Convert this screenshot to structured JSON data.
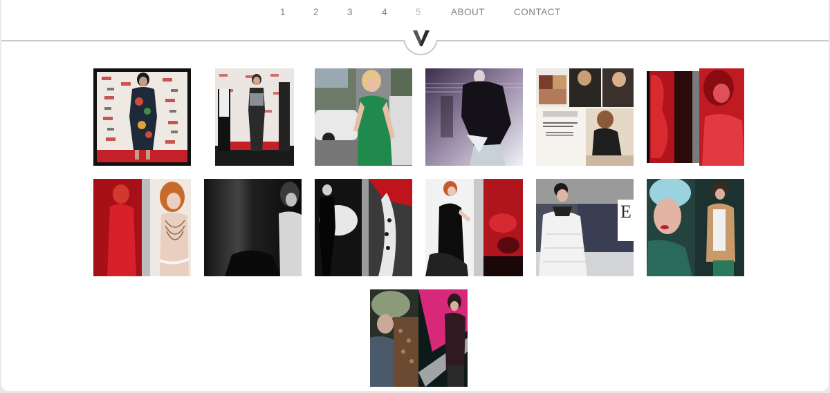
{
  "nav": {
    "items": [
      {
        "label": "1",
        "active": false
      },
      {
        "label": "2",
        "active": false
      },
      {
        "label": "3",
        "active": false
      },
      {
        "label": "4",
        "active": false
      },
      {
        "label": "5",
        "active": true
      },
      {
        "label": "ABOUT",
        "active": false
      },
      {
        "label": "CONTACT",
        "active": false
      }
    ]
  },
  "logo": {
    "letter": "V",
    "icon": "v-logo-icon"
  },
  "gallery": {
    "photos": [
      {
        "name": "photo-red-carpet-floral-dress"
      },
      {
        "name": "photo-red-carpet-interview"
      },
      {
        "name": "photo-green-dress-street"
      },
      {
        "name": "photo-black-jacket-editorial"
      },
      {
        "name": "photo-magazine-collage"
      },
      {
        "name": "photo-red-tinted-spread"
      },
      {
        "name": "photo-red-dress-spread"
      },
      {
        "name": "photo-monochrome-portrait"
      },
      {
        "name": "photo-bw-figure-xray-spread"
      },
      {
        "name": "photo-redhead-black-dress-spread"
      },
      {
        "name": "photo-white-coat-magazine"
      },
      {
        "name": "photo-blue-hair-spread"
      },
      {
        "name": "photo-fur-hat-pink-spread"
      }
    ]
  },
  "colors": {
    "nav_text": "#7a7f86",
    "nav_active": "#b9bdc2",
    "divider": "#c9c9c9",
    "background": "#ffffff"
  }
}
